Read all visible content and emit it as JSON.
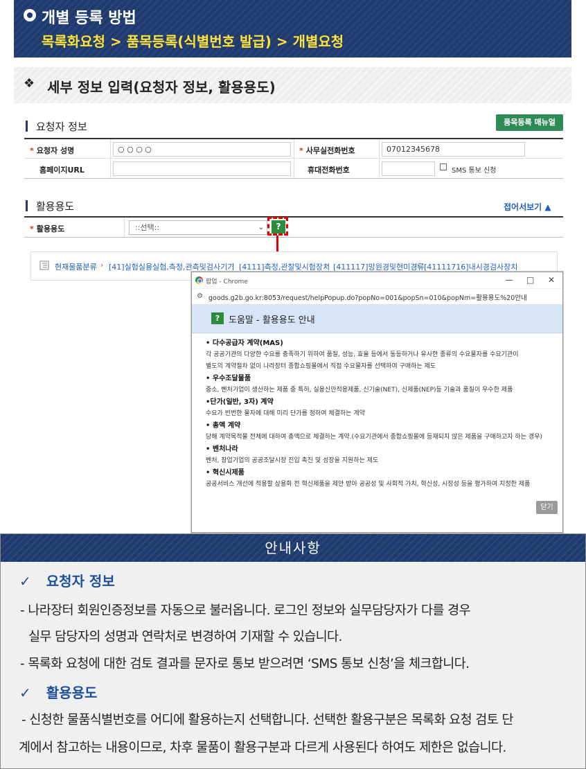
{
  "header": {
    "title": "개별 등록 방법",
    "path": "목록화요청 > 품목등록(식별번호 발급) > 개별요청"
  },
  "section": {
    "marker": "❖",
    "title": "세부 정보 입력(요청자 정보, 활용용도)"
  },
  "requester": {
    "heading": "요청자 정보",
    "manual_button": "품목등록 매뉴얼",
    "required_mark": "*",
    "name_label": "요청자 성명",
    "name_value": "○ ○ ○ ○",
    "office_phone_label": "사무실전화번호",
    "office_phone_value": "07012345678",
    "homepage_label": "홈페이지URL",
    "homepage_value": "",
    "mobile_label": "휴대전화번호",
    "mobile_value": "",
    "sms_label": "SMS 통보 신청"
  },
  "usage": {
    "heading": "활용용도",
    "collapse_link": "접어서보기 ▲",
    "label": "활용용도",
    "select_value": "::선택::",
    "help_mark": "?"
  },
  "breadcrumb": [
    "현재물품분류",
    "[41]실험실용실험,측정,관측및검사기기",
    "[4111]측정,관찰및시험장치",
    "[411117]망원경및현미경류",
    "[41111716]내시경검사장치"
  ],
  "popup": {
    "window_title": "팝업 - Chrome",
    "url": "goods.g2b.go.kr:8053/request/helpPopup.do?popNo=001&popSn=010&popNm=활용용도%20안내",
    "window_buttons": [
      "—",
      "□",
      "✕"
    ],
    "heading": "도움말 - 활용용도 안내",
    "items": [
      {
        "term": "• 다수공급자 계약(MAS)",
        "desc": [
          "각 공공기관의 다양한 수요를 충족하기 위하여 품질, 성능, 효율 등에서 동등하거나 유사한 종류의 수요물자를 수요기관이",
          "별도의 계약절차 없이 나라장터 종합쇼핑몰에서 직접 수요물자를 선택하여 구매하는 제도"
        ]
      },
      {
        "term": "• 우수조달물품",
        "desc": [
          "중소, 벤처기업이 생산하는 제품 중 특허, 실용신안적용제품, 신기술(NET), 신제품(NEP)등 기술과 품질이 우수한 제품"
        ]
      },
      {
        "term": "•단가(일반, 3자) 계약",
        "desc": [
          "수요가 빈번한 물자에 대해 미리 단가를 정하여 체결하는 계약"
        ]
      },
      {
        "term": "• 총액 계약",
        "desc": [
          "당해 계약목적물 전체에 대하여 총액으로 체결하는 계약.(수요기관에서 종합쇼핑몰에 등재되지 않은 제품을 구매하고자 하는 경우)"
        ]
      },
      {
        "term": "• 벤처나라",
        "desc": [
          "벤처, 창업기업의 공공조달시장 진입 촉진 및 성장을 지원하는 제도"
        ]
      },
      {
        "term": "• 혁신시제품",
        "desc": [
          "공공서비스 개선에 적용할 상용화 전 혁신제품을 제안 받아 공공성 및 사회적 가치, 혁신성, 시장성 등을 평가하여 지정한 제품"
        ]
      }
    ],
    "close_button": "닫기"
  },
  "notice": {
    "heading": "안내사항",
    "check_mark": "✓",
    "requester_title": "요청자 정보",
    "requester_lines": [
      "- 나라장터 회원인증정보를 자동으로 불러옵니다. 로그인 정보와 실무담당자가 다를 경우",
      "실무 담당자의 성명과 연락처로 변경하여 기재할 수 있습니다.",
      "- 목록화 요청에 대한 검토 결과를 문자로 통보 받으려면 ‘SMS 통보 신청’을 체크합니다."
    ],
    "usage_title": "활용용도",
    "usage_lines": [
      "- 신청한 물품식별번호를 어디에 활용하는지 선택합니다. 선택한 활용구분은 목록화 요청 검토 단",
      "계에서 참고하는 내용이므로, 차후 물품이 활용구분과 다르게 사용된다 하여도 제한은 없습니다."
    ]
  }
}
